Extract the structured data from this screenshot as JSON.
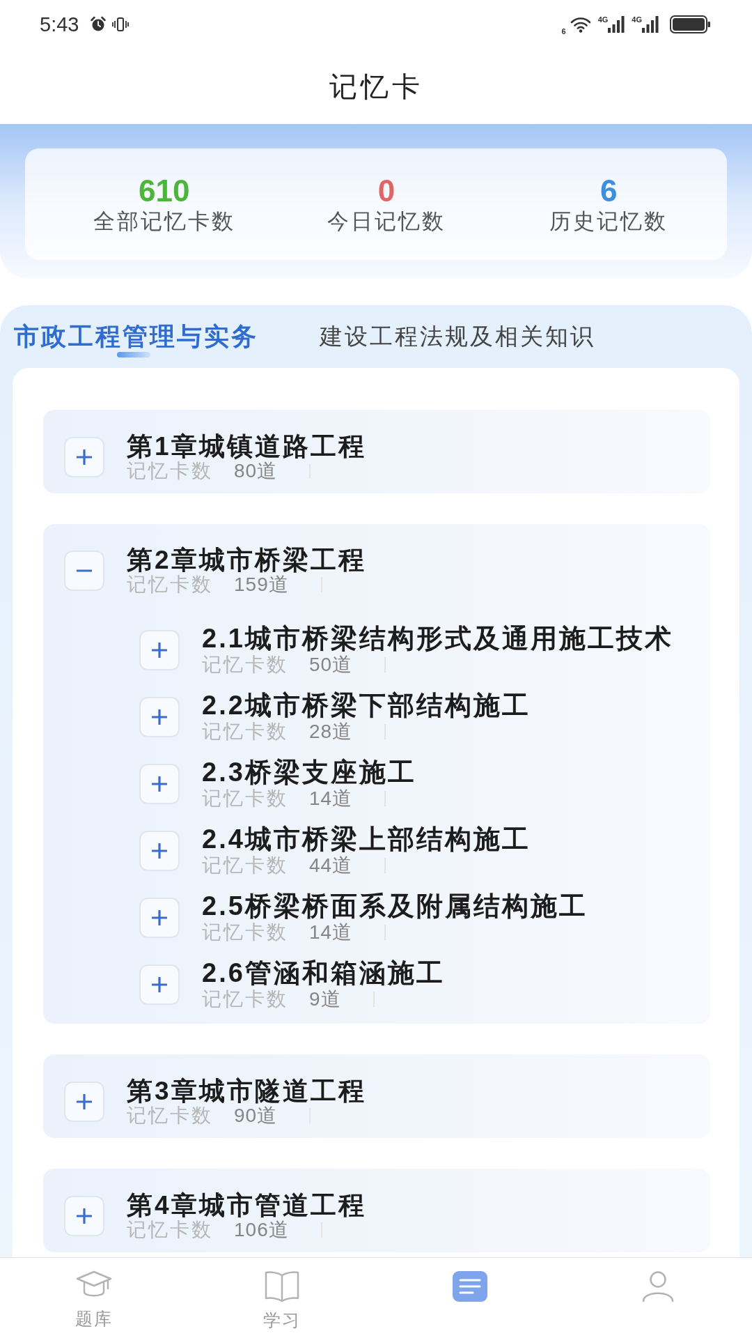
{
  "status_bar": {
    "time": "5:43",
    "wifi_label": "6",
    "cellular": [
      {
        "label": "4G"
      },
      {
        "label": "4G"
      }
    ]
  },
  "header": {
    "title": "记忆卡"
  },
  "stats": [
    {
      "value": "610",
      "label": "全部记忆卡数",
      "color": "#4cb53a"
    },
    {
      "value": "0",
      "label": "今日记忆数",
      "color": "#e06666"
    },
    {
      "value": "6",
      "label": "历史记忆数",
      "color": "#3b8ee0"
    }
  ],
  "tabs": [
    {
      "label": "市政工程管理与实务",
      "selected": true
    },
    {
      "label": "建设工程法规及相关知识",
      "selected": false
    }
  ],
  "chapters": [
    {
      "title": "第1章城镇道路工程",
      "count_label": "记忆卡数",
      "count": "80道",
      "expanded": false
    },
    {
      "title": "第2章城市桥梁工程",
      "count_label": "记忆卡数",
      "count": "159道",
      "expanded": true,
      "children": [
        {
          "title": "2.1城市桥梁结构形式及通用施工技术",
          "count_label": "记忆卡数",
          "count": "50道",
          "expanded": false
        },
        {
          "title": "2.2城市桥梁下部结构施工",
          "count_label": "记忆卡数",
          "count": "28道",
          "expanded": false
        },
        {
          "title": "2.3桥梁支座施工",
          "count_label": "记忆卡数",
          "count": "14道",
          "expanded": false
        },
        {
          "title": "2.4城市桥梁上部结构施工",
          "count_label": "记忆卡数",
          "count": "44道",
          "expanded": false
        },
        {
          "title": "2.5桥梁桥面系及附属结构施工",
          "count_label": "记忆卡数",
          "count": "14道",
          "expanded": false
        },
        {
          "title": "2.6管涵和箱涵施工",
          "count_label": "记忆卡数",
          "count": "9道",
          "expanded": false
        }
      ]
    },
    {
      "title": "第3章城市隧道工程",
      "count_label": "记忆卡数",
      "count": "90道",
      "expanded": false
    },
    {
      "title": "第4章城市管道工程",
      "count_label": "记忆卡数",
      "count": "106道",
      "expanded": false
    }
  ],
  "bottom_nav": [
    {
      "kind": "cap",
      "label": "题库",
      "selected": false
    },
    {
      "kind": "book",
      "label": "学习",
      "selected": false
    },
    {
      "kind": "cards",
      "selected": true
    },
    {
      "kind": "person",
      "selected": false
    }
  ]
}
